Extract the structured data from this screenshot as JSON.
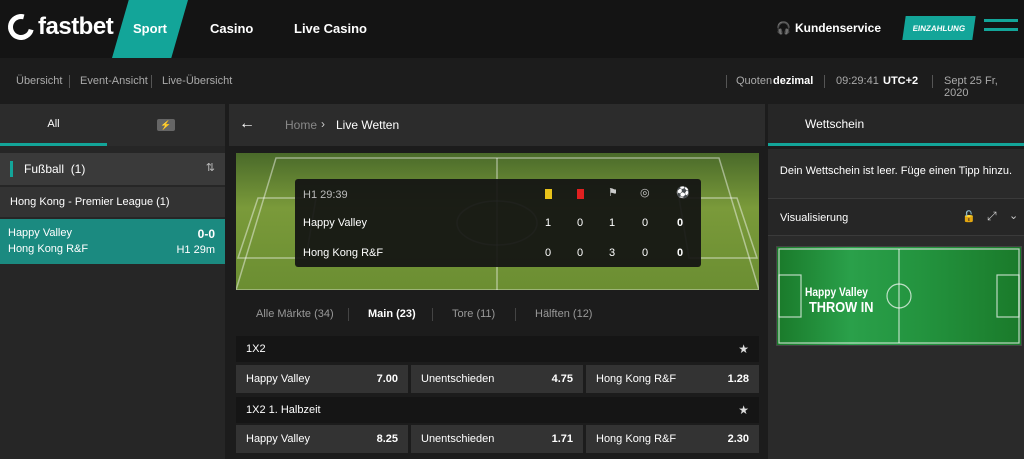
{
  "brand": {
    "name": "fastbet"
  },
  "nav": {
    "sport": "Sport",
    "casino": "Casino",
    "live_casino": "Live Casino",
    "support": "Kundenservice",
    "deposit": "EINZAHLUNG"
  },
  "subnav": {
    "overview": "Übersicht",
    "event_view": "Event-Ansicht",
    "live_overview": "Live-Übersicht",
    "odds_label": "Quoten",
    "odds_format": "dezimal",
    "time": "09:29:41",
    "timezone": "UTC+2",
    "date": "Sept 25 Fr, 2020"
  },
  "sidebar": {
    "tab_all": "All",
    "sport": "Fußball",
    "sport_count": "(1)",
    "league": "Hong Kong - Premier League (1)",
    "match": {
      "home": "Happy Valley",
      "away": "Hong Kong R&F",
      "score": "0-0",
      "time": "H1 29m"
    }
  },
  "breadcrumb": {
    "home": "Home",
    "current": "Live Wetten"
  },
  "scoreboard": {
    "clock": "H1 29:39",
    "rows": [
      {
        "team": "Happy Valley",
        "yellow": "1",
        "red": "0",
        "corners": "1",
        "pen": "0",
        "goals": "0"
      },
      {
        "team": "Hong Kong R&F",
        "yellow": "0",
        "red": "0",
        "corners": "3",
        "pen": "0",
        "goals": "0"
      }
    ]
  },
  "filters": [
    {
      "label": "Alle Märkte (34)"
    },
    {
      "label": "Main (23)"
    },
    {
      "label": "Tore (11)"
    },
    {
      "label": "Hälften (12)"
    }
  ],
  "markets": [
    {
      "title": "1X2",
      "odds": [
        {
          "name": "Happy Valley",
          "value": "7.00"
        },
        {
          "name": "Unentschieden",
          "value": "4.75"
        },
        {
          "name": "Hong Kong R&F",
          "value": "1.28"
        }
      ]
    },
    {
      "title": "1X2 1. Halbzeit",
      "odds": [
        {
          "name": "Happy Valley",
          "value": "8.25"
        },
        {
          "name": "Unentschieden",
          "value": "1.71"
        },
        {
          "name": "Hong Kong R&F",
          "value": "2.30"
        }
      ]
    }
  ],
  "betslip": {
    "title": "Wettschein",
    "empty": "Dein Wettschein ist leer. Füge einen Tipp hinzu.",
    "visual_title": "Visualisierung",
    "event_team": "Happy Valley",
    "event_action": "THROW IN"
  },
  "colors": {
    "accent": "#13a599"
  }
}
